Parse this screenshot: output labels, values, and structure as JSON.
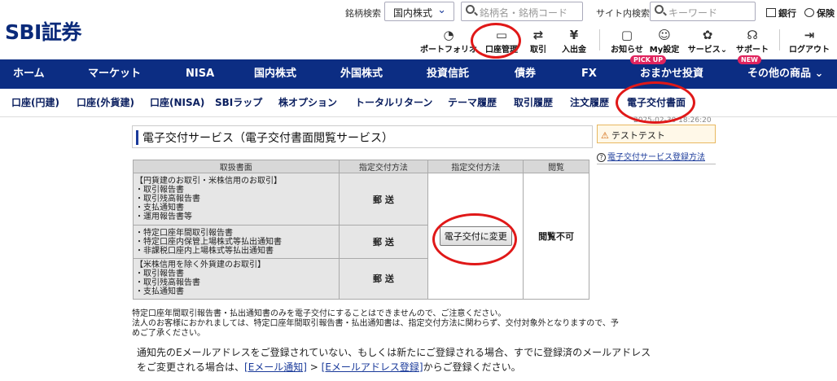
{
  "brand": {
    "logo": "SBI証券"
  },
  "top": {
    "stock_search_label": "銘柄検索",
    "market_select": "国内株式",
    "stock_search_placeholder": "銘柄名・銘柄コード",
    "site_search_label": "サイト内検索",
    "site_search_placeholder": "キーワード",
    "bank_link": "銀行",
    "insurance_link": "保険"
  },
  "icon_nav": [
    {
      "label": "ポートフォリオ",
      "icon": "portfolio-icon"
    },
    {
      "label": "口座管理",
      "icon": "account-icon"
    },
    {
      "label": "取引",
      "icon": "trade-icon"
    },
    {
      "label": "入出金",
      "icon": "deposit-icon"
    },
    {
      "label": "お知らせ",
      "icon": "notice-icon"
    },
    {
      "label": "My設定",
      "icon": "settings-icon"
    },
    {
      "label": "サービス",
      "icon": "service-icon"
    },
    {
      "label": "サポート",
      "icon": "support-icon"
    },
    {
      "label": "ログアウト",
      "icon": "logout-icon"
    }
  ],
  "main_nav": [
    "ホーム",
    "マーケット",
    "NISA",
    "国内株式",
    "外国株式",
    "投資信託",
    "債券",
    "FX",
    "おまかせ投資",
    "その他の商品"
  ],
  "badges": {
    "pickup": "PICK UP",
    "new": "NEW"
  },
  "sub_nav": [
    "口座(円建)",
    "口座(外貨建)",
    "口座(NISA)",
    "SBIラップ",
    "株オプション",
    "トータルリターン",
    "テーマ履歴",
    "取引履歴",
    "注文履歴",
    "電子交付書面"
  ],
  "timestamp": "2025-02-30 18:26:20",
  "page_title": "電子交付サービス（電子交付書面閲覧サービス）",
  "table": {
    "headers": [
      "取扱書面",
      "指定交付方法",
      "指定交付方法",
      "閲覧"
    ],
    "rows": [
      {
        "items": "【円貨建のお取引・米株信用のお取引】\n・取引報告書\n・取引残高報告書\n・支払通知書\n・運用報告書等",
        "method": "郵 送"
      },
      {
        "items": "・特定口座年間取引報告書\n・特定口座内保管上場株式等払出通知書\n・非課税口座内上場株式等払出通知書",
        "method": "郵 送"
      },
      {
        "items": "【米株信用を除く外貨建のお取引】\n・取引報告書\n・取引残高報告書\n・支払通知書",
        "method": "郵 送"
      }
    ],
    "change_button": "電子交付に変更",
    "view_status": "閲覧不可"
  },
  "notes": {
    "line1": "特定口座年間取引報告書・払出通知書のみを電子交付にすることはできませんので、ご注意ください。",
    "line2": "法人のお客様におかれましては、特定口座年間取引報告書・払出通知書は、指定交付方法に関わらず、交付対象外となりますので、予",
    "line3": "めご了承ください。",
    "email_line1": "通知先のEメールアドレスをご登録されていない、もしくは新たにご登録される場合、すでに登録済のメールアドレス",
    "email_line2_pre": "をご変更される場合は、",
    "email_link1": "[Eメール通知]",
    "email_sep": " > ",
    "email_link2": "[Eメールアドレス登録]",
    "email_line2_post": "からご登録ください。"
  },
  "side": {
    "warn": "テストテスト",
    "help_link": "電子交付サービス登録方法"
  },
  "colors": {
    "nav_bg": "#0c2d83",
    "annotation": "#e01818"
  }
}
